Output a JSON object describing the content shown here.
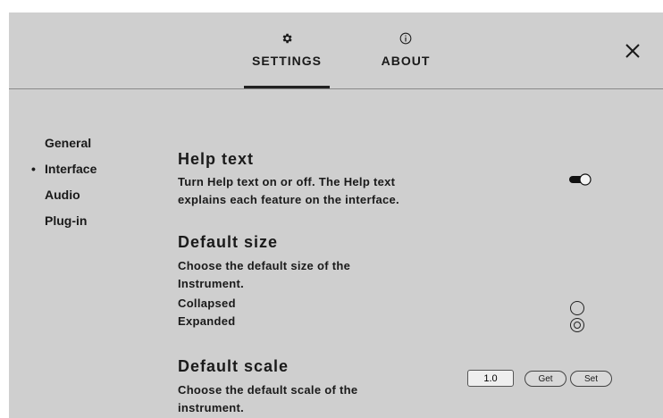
{
  "header": {
    "tabs": [
      {
        "label": "SETTINGS",
        "icon": "gear-icon",
        "active": true
      },
      {
        "label": "ABOUT",
        "icon": "info-icon",
        "active": false
      }
    ],
    "close_icon": "close-icon"
  },
  "sidebar": {
    "items": [
      {
        "label": "General",
        "active": false
      },
      {
        "label": "Interface",
        "active": true
      },
      {
        "label": "Audio",
        "active": false
      },
      {
        "label": "Plug-in",
        "active": false
      }
    ],
    "active_marker": "•"
  },
  "sections": {
    "help_text": {
      "title": "Help text",
      "description_line1": "Turn Help text on or off. The Help text",
      "description_line2": "explains each feature on the interface.",
      "toggle_on": true
    },
    "default_size": {
      "title": "Default size",
      "description_line1": "Choose the default size of the",
      "description_line2": "Instrument.",
      "options": [
        {
          "label": "Collapsed",
          "selected": false
        },
        {
          "label": "Expanded",
          "selected": true
        }
      ]
    },
    "default_scale": {
      "title": "Default scale",
      "description_line1": "Choose the default scale of the",
      "description_line2": "instrument.",
      "value": "1.0",
      "get_label": "Get",
      "set_label": "Set"
    }
  },
  "colors": {
    "panel_bg": "#cfcfcf",
    "text": "#1a1a1a",
    "divider": "#8a8a8a"
  }
}
